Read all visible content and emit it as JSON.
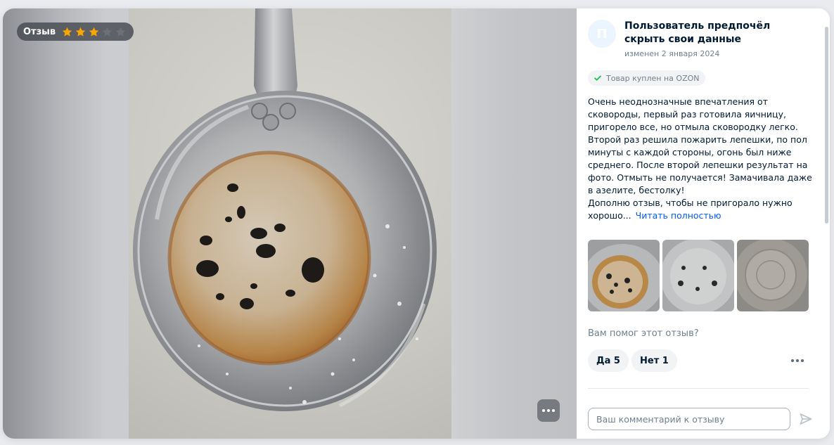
{
  "media": {
    "badge_label": "Отзыв",
    "rating": 3,
    "rating_max": 5
  },
  "author": {
    "avatar_letter": "П",
    "name": "Пользователь предпочёл скрыть свои данные",
    "date": "изменен 2 января 2024"
  },
  "bought_badge": "Товар куплен на OZON",
  "review": {
    "text_lines": [
      "Очень неоднозначные впечатления от сковороды, первый раз готовила яичницу, пригорело все, но отмыла сковородку легко. Второй раз решила пожарить лепешки, по пол минуты с каждой стороны, огонь был ниже среднего. После второй лепешки результат на фото. Отмыть не получается! Замачивала даже в азелите, бестолку!",
      "Дополню отзыв, чтобы не пригорало нужно хорошо..."
    ],
    "read_more": "Читать полностью"
  },
  "helpful": {
    "question": "Вам помог этот отзыв?",
    "yes_label": "Да 5",
    "no_label": "Нет 1"
  },
  "comment": {
    "placeholder": "Ваш комментарий к отзыву"
  },
  "colors": {
    "star_filled": "#f9a600",
    "star_empty": "#6d7177",
    "link": "#005bff",
    "check": "#10c44c"
  },
  "icons": [
    "star-icon",
    "check-icon",
    "more-dots-icon",
    "send-icon"
  ]
}
